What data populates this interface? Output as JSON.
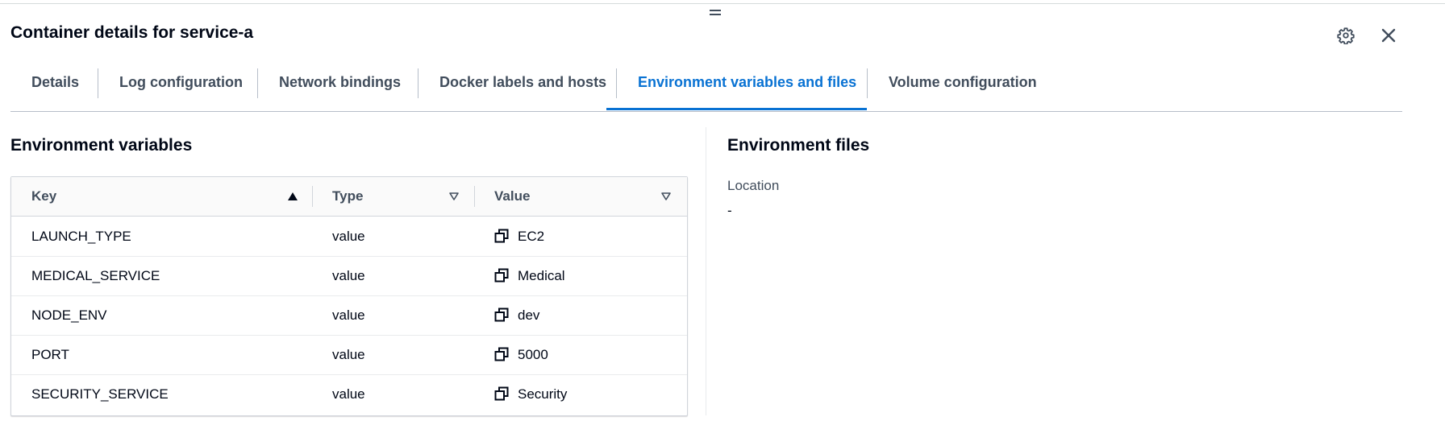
{
  "modal": {
    "title": "Container details for service-a"
  },
  "icons": {
    "drag": "drag-handle-icon",
    "settings": "gear-icon",
    "close": "close-icon",
    "copy": "copy-icon",
    "sort_asc": "sort-ascending-icon",
    "sort_none": "sort-indicator-icon"
  },
  "tabs": [
    {
      "label": "Details",
      "active": false
    },
    {
      "label": "Log configuration",
      "active": false
    },
    {
      "label": "Network bindings",
      "active": false
    },
    {
      "label": "Docker labels and hosts",
      "active": false
    },
    {
      "label": "Environment variables and files",
      "active": true
    },
    {
      "label": "Volume configuration",
      "active": false
    }
  ],
  "env_vars": {
    "heading": "Environment variables",
    "columns": [
      {
        "label": "Key",
        "sort": "ascending"
      },
      {
        "label": "Type",
        "sort": "none"
      },
      {
        "label": "Value",
        "sort": "none"
      }
    ],
    "rows": [
      {
        "key": "LAUNCH_TYPE",
        "type": "value",
        "value": "EC2"
      },
      {
        "key": "MEDICAL_SERVICE",
        "type": "value",
        "value": "Medical"
      },
      {
        "key": "NODE_ENV",
        "type": "value",
        "value": "dev"
      },
      {
        "key": "PORT",
        "type": "value",
        "value": "5000"
      },
      {
        "key": "SECURITY_SERVICE",
        "type": "value",
        "value": "Security"
      }
    ]
  },
  "env_files": {
    "heading": "Environment files",
    "location_label": "Location",
    "location_value": "-"
  },
  "colors": {
    "accent": "#0972d3",
    "text": "#000716",
    "secondary_text": "#414d5c",
    "border": "#d1d5db"
  }
}
